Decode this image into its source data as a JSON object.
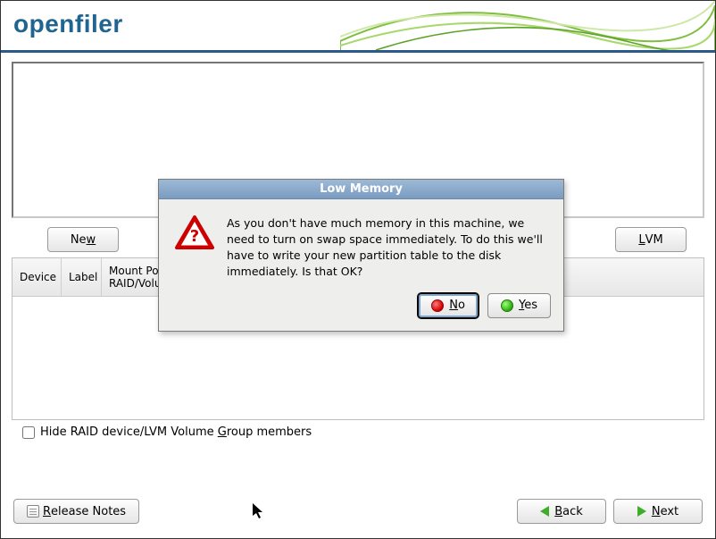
{
  "brand": "openfiler",
  "toolbar": {
    "new_prefix": "Ne",
    "new_ul": "w",
    "lvm_ul": "L",
    "lvm_suffix": "VM"
  },
  "table": {
    "device": "Device",
    "label": "Label",
    "mount_line1": "Mount Point/",
    "mount_line2": "RAID/Volume"
  },
  "hide_checkbox": {
    "prefix": "Hide RAID device/LVM Volume ",
    "ul": "G",
    "suffix": "roup members"
  },
  "footer": {
    "release_ul": "R",
    "release_suffix": "elease Notes",
    "back_ul": "B",
    "back_suffix": "ack",
    "next_ul": "N",
    "next_suffix": "ext"
  },
  "dialog": {
    "title": "Low Memory",
    "message": "As you don't have much memory in this machine, we need to turn on swap space immediately. To do this we'll have to write your new partition table to the disk immediately. Is that OK?",
    "no_ul": "N",
    "no_suffix": "o",
    "yes_ul": "Y",
    "yes_suffix": "es"
  }
}
